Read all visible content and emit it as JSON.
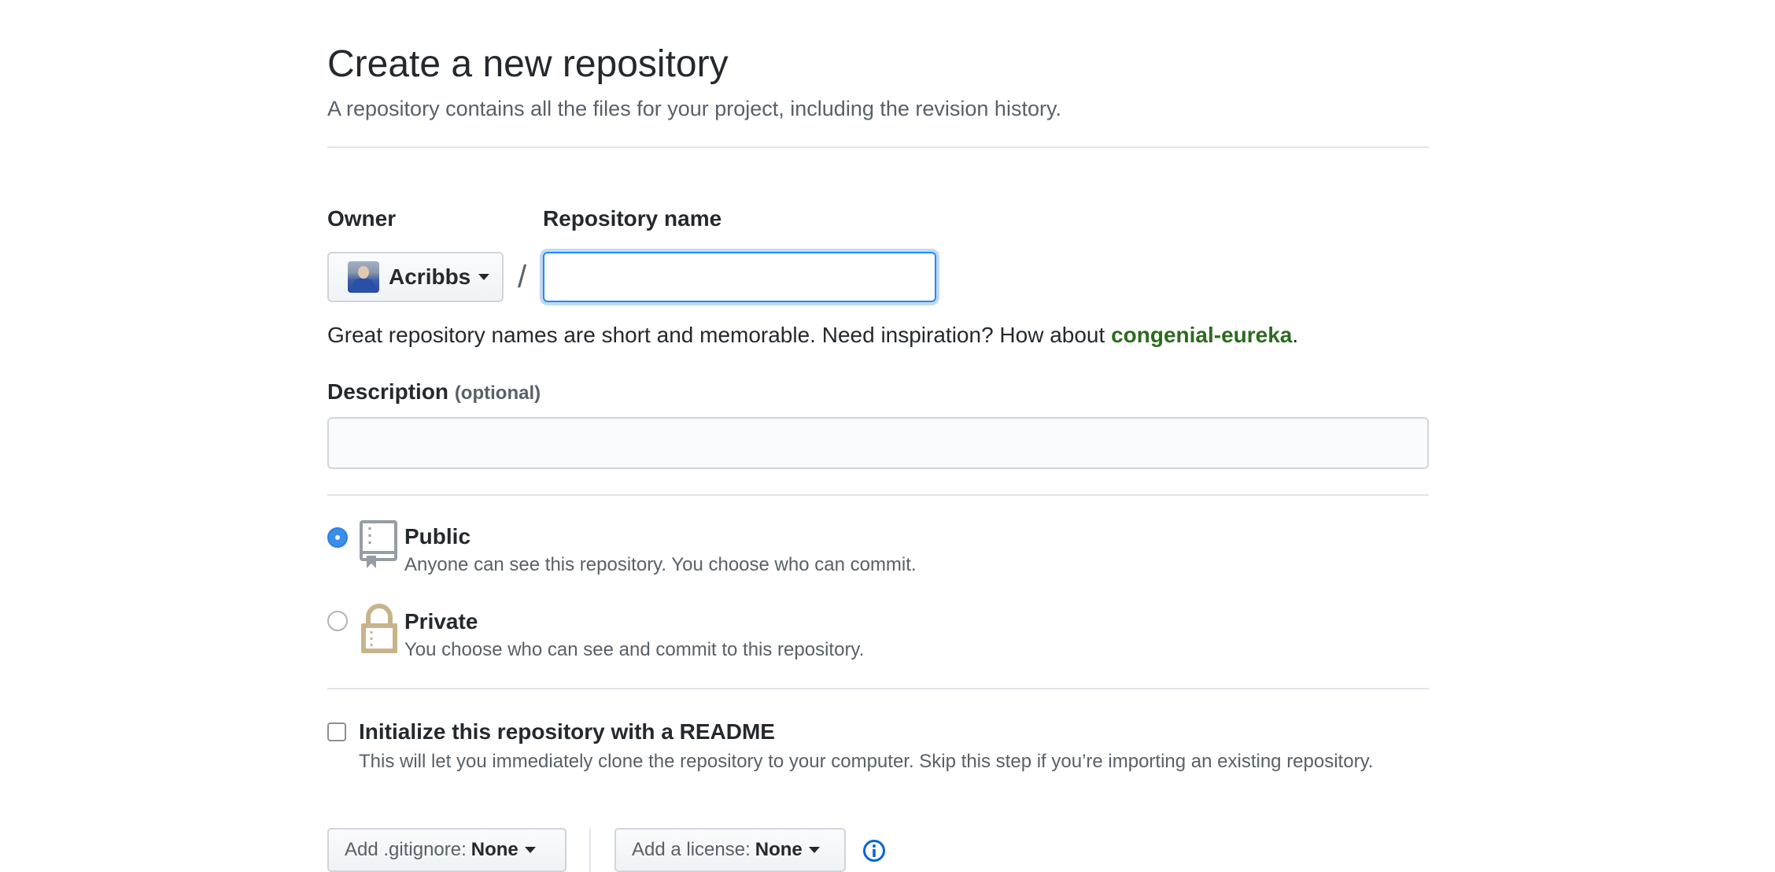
{
  "header": {
    "title": "Create a new repository",
    "subtitle": "A repository contains all the files for your project, including the revision history."
  },
  "owner": {
    "label": "Owner",
    "name": "Acribbs"
  },
  "repository": {
    "label": "Repository name",
    "separator": "/",
    "value": "",
    "hint_prefix": "Great repository names are short and memorable. Need inspiration? How about ",
    "suggestion": "congenial-eureka",
    "hint_suffix": "."
  },
  "description": {
    "label": "Description",
    "optional": "(optional)",
    "value": ""
  },
  "visibility": {
    "selected": "public",
    "public": {
      "title": "Public",
      "description": "Anyone can see this repository. You choose who can commit."
    },
    "private": {
      "title": "Private",
      "description": "You choose who can see and commit to this repository."
    }
  },
  "readme": {
    "checked": false,
    "title": "Initialize this repository with a README",
    "description": "This will let you immediately clone the repository to your computer. Skip this step if you’re importing an existing repository."
  },
  "gitignore": {
    "label": "Add .gitignore:",
    "value": "None"
  },
  "license": {
    "label": "Add a license:",
    "value": "None"
  },
  "colors": {
    "focus_border": "#2188ff",
    "suggestion": "#2c6b1f",
    "radio_checked": "#3b8eea",
    "lock_icon": "#c8b48c",
    "repo_icon": "#959da5",
    "info_icon": "#0366d6"
  },
  "icons": {
    "public": "repo-icon",
    "private": "lock-icon",
    "info": "info-icon"
  }
}
